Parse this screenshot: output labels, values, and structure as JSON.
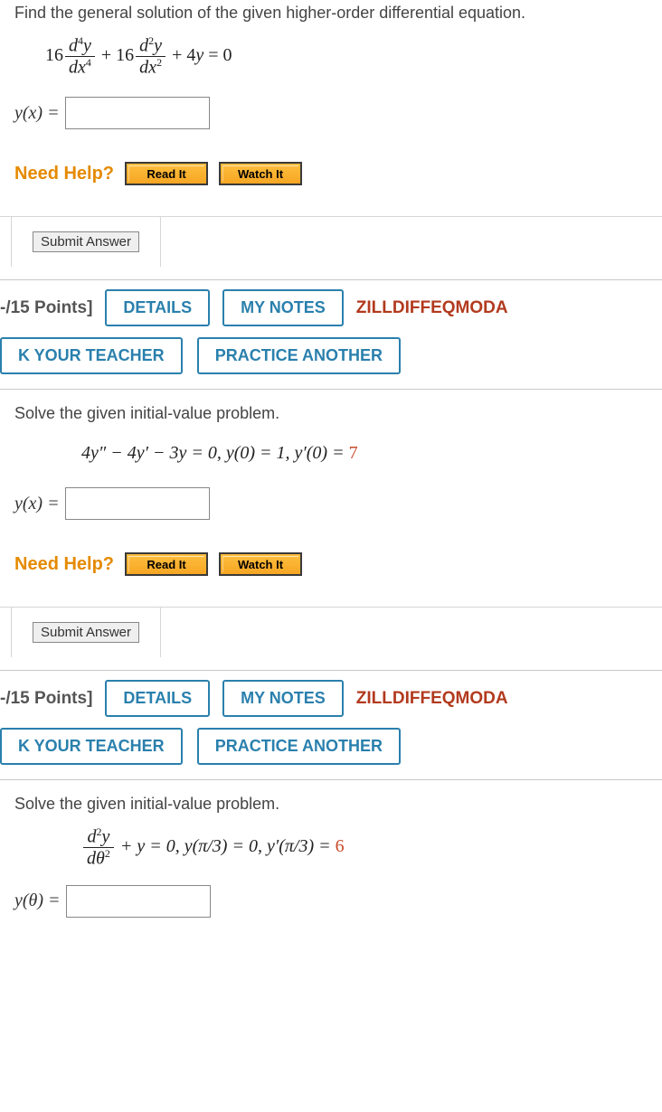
{
  "q1": {
    "prompt": "Find the general solution of the given higher-order differential equation.",
    "answer_var": "y(x) =",
    "need_help": "Need Help?",
    "read": "Read It",
    "watch": "Watch It",
    "submit": "Submit Answer"
  },
  "header2": {
    "points": "-/15 Points]",
    "details": "DETAILS",
    "mynotes": "MY NOTES",
    "source": "ZILLDIFFEQMODA",
    "askteacher": "K YOUR TEACHER",
    "practice": "PRACTICE ANOTHER"
  },
  "q2": {
    "prompt": "Solve the given initial-value problem.",
    "eq_text": "4y″ − 4y′ − 3y = 0,   y(0) = 1,   y′(0) = ",
    "eq_val": "7",
    "answer_var": "y(x) =",
    "need_help": "Need Help?",
    "read": "Read It",
    "watch": "Watch It",
    "submit": "Submit Answer"
  },
  "header3": {
    "points": "-/15 Points]",
    "details": "DETAILS",
    "mynotes": "MY NOTES",
    "source": "ZILLDIFFEQMODA",
    "askteacher": "K YOUR TEACHER",
    "practice": "PRACTICE ANOTHER"
  },
  "q3": {
    "prompt": "Solve the given initial-value problem.",
    "eq_tail": " + y = 0,    y(π/3) = 0,    y′(π/3) = ",
    "eq_val": "6",
    "answer_var": "y(θ) ="
  }
}
